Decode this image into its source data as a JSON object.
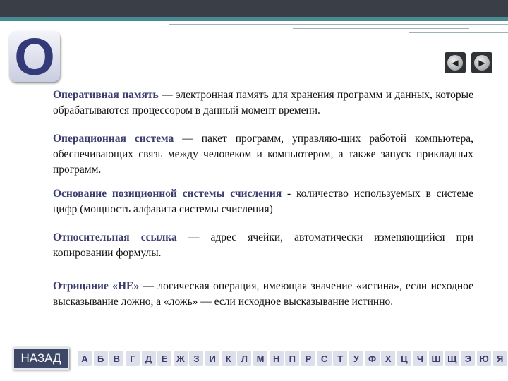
{
  "slide": {
    "letter": "О",
    "nav": {
      "prev_icon": "arrow-left-icon",
      "next_icon": "arrow-right-icon"
    },
    "definitions": [
      {
        "term": "Оперативная память",
        "text": " — электронная память для хранения программ и данных, которые обрабатываются процессором в данный момент времени."
      },
      {
        "term": "Операционная система",
        "text": " — пакет программ, управляю-щих работой компьютера, обеспечивающих связь между человеком и компьютером, а также запуск прикладных программ."
      },
      {
        "term": "Основание позиционной системы счисления",
        "text": " - количество используемых в системе цифр (мощность алфавита системы счисления)"
      },
      {
        "term": "Относительная ссылка",
        "text": " — адрес ячейки, автоматически изменяющийся при копировании формулы."
      },
      {
        "term": "Отрицание «НЕ»",
        "text": " — логическая операция, имеющая значение «истина», если исходное высказывание ложно, а «ложь» — если исходное высказывание истинно."
      }
    ],
    "back_label": "НАЗАД",
    "alphabet": [
      "А",
      "Б",
      "В",
      "Г",
      "Д",
      "Е",
      "Ж",
      "З",
      "И",
      "К",
      "Л",
      "М",
      "Н",
      "П",
      "Р",
      "С",
      "Т",
      "У",
      "Ф",
      "Х",
      "Ц",
      "Ч",
      "Ш",
      "Щ",
      "Э",
      "Ю",
      "Я"
    ]
  }
}
